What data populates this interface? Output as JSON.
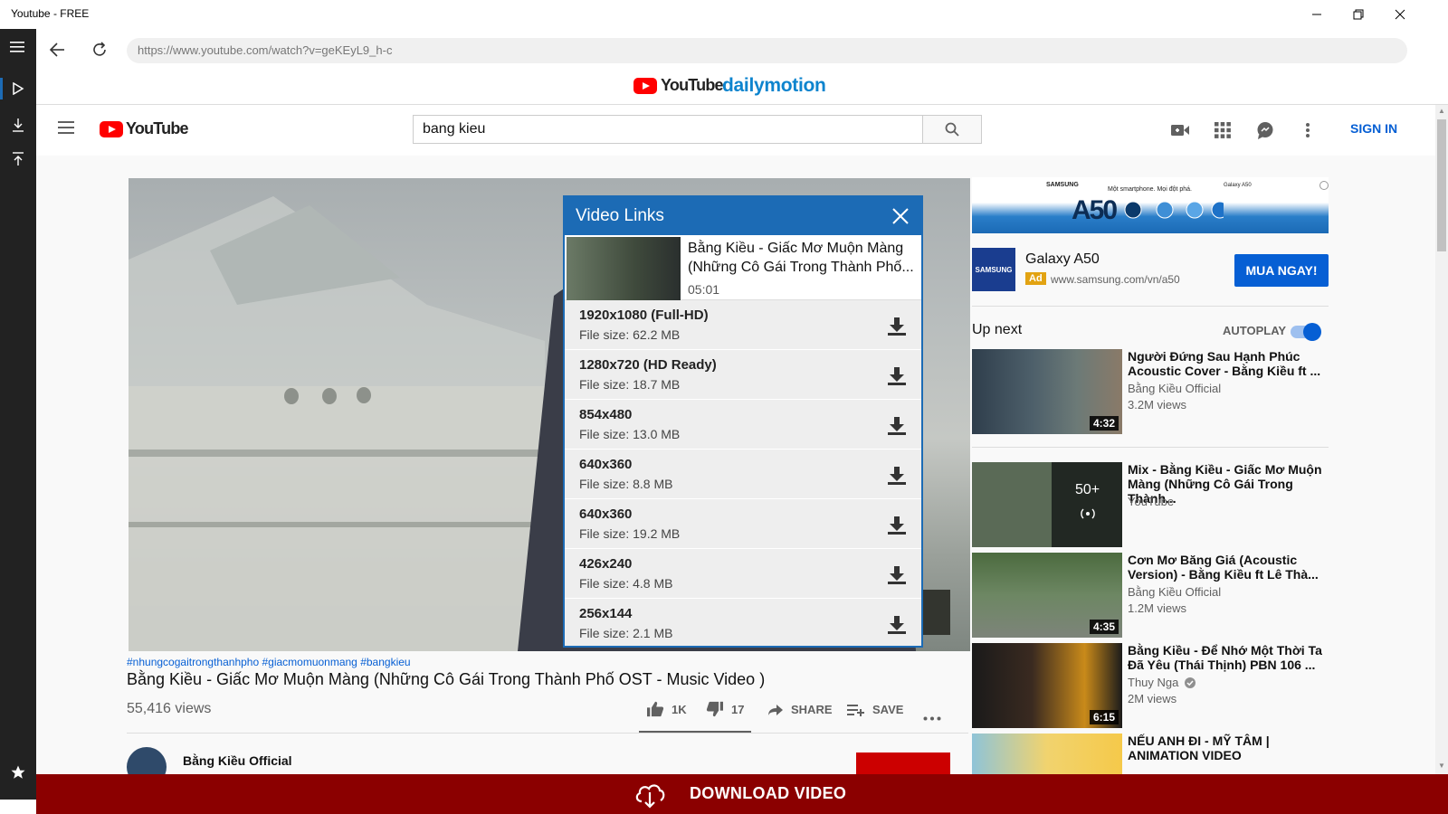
{
  "window": {
    "title": "Youtube - FREE"
  },
  "browser": {
    "url": "https://www.youtube.com/watch?v=geKEyL9_h-c"
  },
  "sites": {
    "youtube": "YouTube",
    "dailymotion": "dailymotion"
  },
  "youtube": {
    "logo": "YouTube",
    "search_value": "bang kieu",
    "sign_in": "SIGN IN"
  },
  "video": {
    "hashtags": "#nhungcogaitrongthanhpho #giacmomuonmang #bangkieu",
    "title": "Bằng Kiều - Giấc Mơ Muộn Màng (Những Cô Gái Trong Thành Phố OST - Music Video )",
    "views": "55,416 views",
    "likes": "1K",
    "dislikes": "17",
    "share": "SHARE",
    "save": "SAVE",
    "channel_partial": "Bằng Kiều Official"
  },
  "modal": {
    "header": "Video Links",
    "video_title": "Bằng Kiều - Giấc Mơ Muộn Màng (Những Cô Gái Trong Thành Phố...",
    "duration": "05:01",
    "links": [
      {
        "resolution": "1920x1080 (Full-HD)",
        "size": "File size: 62.2 MB"
      },
      {
        "resolution": "1280x720 (HD Ready)",
        "size": "File size: 18.7 MB"
      },
      {
        "resolution": "854x480",
        "size": "File size: 13.0 MB"
      },
      {
        "resolution": "640x360",
        "size": "File size: 8.8 MB"
      },
      {
        "resolution": "640x360",
        "size": "File size: 19.2 MB"
      },
      {
        "resolution": "426x240",
        "size": "File size: 4.8 MB"
      },
      {
        "resolution": "256x144",
        "size": "File size: 2.1 MB"
      }
    ]
  },
  "ad": {
    "brand": "SAMSUNG",
    "tagline": "Một smartphone. Mọi đột phá.",
    "model_small": "Galaxy A50",
    "model_big": "A50",
    "product": "Galaxy A50",
    "badge": "Ad",
    "url": "www.samsung.com/vn/a50",
    "cta": "MUA NGAY!"
  },
  "upnext": {
    "label": "Up next",
    "autoplay": "AUTOPLAY",
    "autoplay_on": true,
    "items": [
      {
        "title": "Người Đứng Sau Hạnh Phúc Acoustic Cover - Bằng Kiều ft ...",
        "channel": "Bằng Kiều Official",
        "views": "3.2M views",
        "duration": "4:32"
      },
      {
        "title": "Mix - Bằng Kiều - Giấc Mơ Muộn Màng (Những Cô Gái Trong Thành...",
        "channel": "YouTube",
        "views": "",
        "duration": "",
        "mix_count": "50+"
      },
      {
        "title": "Cơn Mơ Băng Giá (Acoustic Version) - Bằng Kiều ft Lê Thà...",
        "channel": "Bằng Kiều Official",
        "views": "1.2M views",
        "duration": "4:35"
      },
      {
        "title": "Bằng Kiều - Để Nhớ Một Thời Ta Đã Yêu (Thái Thịnh) PBN 106 ...",
        "channel": "Thuy Nga",
        "views": "2M views",
        "duration": "6:15"
      },
      {
        "title": "NẾU ANH ĐI - MỸ TÂM | ANIMATION VIDEO",
        "channel": "",
        "views": "",
        "duration": ""
      }
    ]
  },
  "download_bar": {
    "label": "DOWNLOAD VIDEO"
  },
  "colors": {
    "accent": "#1c6bb5",
    "download_bar": "#8b0000",
    "yt_red": "#ff0000",
    "link_blue": "#065fd4"
  }
}
